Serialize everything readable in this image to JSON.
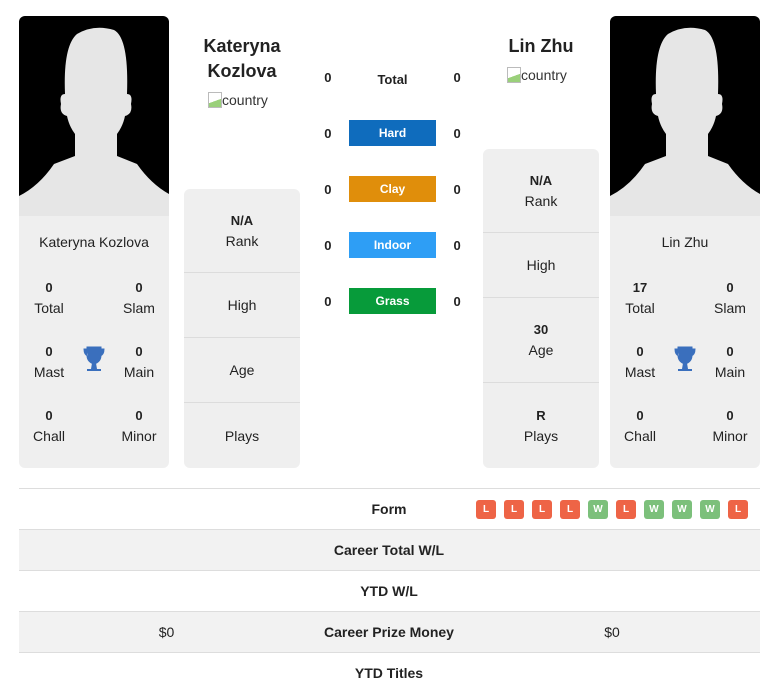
{
  "player1": {
    "name": "Kateryna Kozlova",
    "name_line1": "Kateryna",
    "name_line2": "Kozlova",
    "country_alt": "country",
    "titles": {
      "total": "0",
      "total_label": "Total",
      "slam": "0",
      "slam_label": "Slam",
      "mast": "0",
      "mast_label": "Mast",
      "main": "0",
      "main_label": "Main",
      "chall": "0",
      "chall_label": "Chall",
      "minor": "0",
      "minor_label": "Minor"
    },
    "stats": {
      "rank": "N/A",
      "rank_label": "Rank",
      "high": "",
      "high_label": "High",
      "age": "",
      "age_label": "Age",
      "plays": "",
      "plays_label": "Plays"
    }
  },
  "player2": {
    "name": "Lin Zhu",
    "country_alt": "country",
    "titles": {
      "total": "17",
      "total_label": "Total",
      "slam": "0",
      "slam_label": "Slam",
      "mast": "0",
      "mast_label": "Mast",
      "main": "0",
      "main_label": "Main",
      "chall": "0",
      "chall_label": "Chall",
      "minor": "0",
      "minor_label": "Minor"
    },
    "stats": {
      "rank": "N/A",
      "rank_label": "Rank",
      "high": "",
      "high_label": "High",
      "age": "30",
      "age_label": "Age",
      "plays": "R",
      "plays_label": "Plays"
    }
  },
  "h2h": [
    {
      "label": "Total",
      "p1": "0",
      "p2": "0",
      "color": ""
    },
    {
      "label": "Hard",
      "p1": "0",
      "p2": "0",
      "color": "#0f6cbd"
    },
    {
      "label": "Clay",
      "p1": "0",
      "p2": "0",
      "color": "#e08e0b"
    },
    {
      "label": "Indoor",
      "p1": "0",
      "p2": "0",
      "color": "#2e9ef5"
    },
    {
      "label": "Grass",
      "p1": "0",
      "p2": "0",
      "color": "#079b3a"
    }
  ],
  "comparison": {
    "form_label": "Form",
    "form": [
      "L",
      "L",
      "L",
      "L",
      "W",
      "L",
      "W",
      "W",
      "W",
      "L"
    ],
    "form_colors": {
      "L": "#ee6446",
      "W": "#7cc07b"
    },
    "rows": [
      {
        "label": "Career Total W/L",
        "p1": "",
        "p2": ""
      },
      {
        "label": "YTD W/L",
        "p1": "",
        "p2": ""
      },
      {
        "label": "Career Prize Money",
        "p1": "$0",
        "p2": "$0"
      },
      {
        "label": "YTD Titles",
        "p1": "",
        "p2": ""
      }
    ]
  }
}
